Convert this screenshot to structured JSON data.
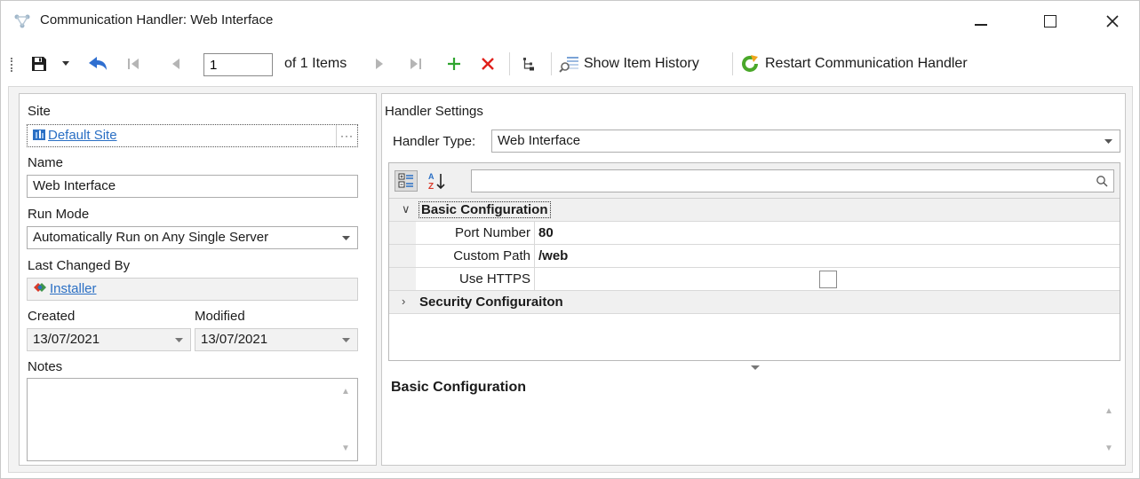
{
  "window": {
    "title": "Communication Handler: Web Interface"
  },
  "toolbar": {
    "page_value": "1",
    "items_text": "of 1 Items",
    "show_history_label": "Show Item History",
    "restart_label": "Restart Communication Handler"
  },
  "left": {
    "site_label": "Site",
    "site_value": "Default Site",
    "site_button": "···",
    "name_label": "Name",
    "name_value": "Web Interface",
    "run_mode_label": "Run Mode",
    "run_mode_value": "Automatically Run on Any Single Server",
    "last_changed_label": "Last Changed By",
    "last_changed_value": "Installer",
    "created_label": "Created",
    "created_value": "13/07/2021",
    "modified_label": "Modified",
    "modified_value": "13/07/2021",
    "notes_label": "Notes",
    "notes_value": ""
  },
  "right": {
    "settings_label": "Handler Settings",
    "handler_type_label": "Handler Type:",
    "handler_type_value": "Web Interface",
    "search_value": "",
    "categories": [
      {
        "label": "Basic Configuration",
        "expanded": true,
        "properties": [
          {
            "name": "Port Number",
            "value": "80"
          },
          {
            "name": "Custom Path",
            "value": "/web"
          },
          {
            "name": "Use HTTPS",
            "value": "",
            "checked": false
          }
        ]
      },
      {
        "label": "Security Configuraiton",
        "expanded": false
      }
    ],
    "description_title": "Basic Configuration"
  },
  "colors": {
    "accent_link": "#2a6fc4",
    "add_green": "#2fa52f",
    "delete_red": "#e0201b",
    "nav_blue": "#2f6fd0"
  }
}
